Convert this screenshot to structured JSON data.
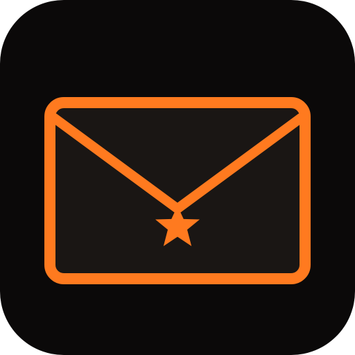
{
  "icon": {
    "name": "envelope-star-app-icon",
    "description_icon": "mail-icon-with-star",
    "colors": {
      "tile_background": "#0b0909",
      "envelope_fill": "#1a1614",
      "accent_orange": "#ff7a1f"
    }
  }
}
